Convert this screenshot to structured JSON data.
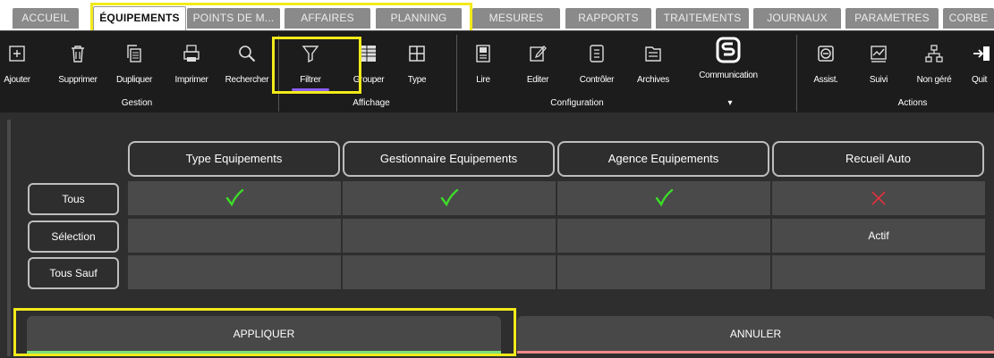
{
  "tabs": [
    {
      "label": "ACCUEIL"
    },
    {
      "label": "ÉQUIPEMENTS"
    },
    {
      "label": "POINTS DE M..."
    },
    {
      "label": "AFFAIRES"
    },
    {
      "label": "PLANNING"
    },
    {
      "label": "MESURES"
    },
    {
      "label": "RAPPORTS"
    },
    {
      "label": "TRAITEMENTS"
    },
    {
      "label": "JOURNAUX"
    },
    {
      "label": "PARAMETRES"
    },
    {
      "label": "CORBE"
    }
  ],
  "ribbon": {
    "buttons": [
      {
        "label": "Ajouter",
        "icon": "add-icon"
      },
      {
        "label": "Supprimer",
        "icon": "trash-icon"
      },
      {
        "label": "Dupliquer",
        "icon": "duplicate-icon"
      },
      {
        "label": "Imprimer",
        "icon": "printer-icon"
      },
      {
        "label": "Rechercher",
        "icon": "search-icon"
      },
      {
        "label": "Filtrer",
        "icon": "filter-icon"
      },
      {
        "label": "Grouper",
        "icon": "group-icon"
      },
      {
        "label": "Type",
        "icon": "grid-icon"
      },
      {
        "label": "Lire",
        "icon": "read-icon"
      },
      {
        "label": "Editer",
        "icon": "edit-icon"
      },
      {
        "label": "Contrôler",
        "icon": "check-icon"
      },
      {
        "label": "Archives",
        "icon": "archive-icon"
      },
      {
        "label": "Communication",
        "icon": "communication-icon"
      },
      {
        "label": "Assist.",
        "icon": "assist-icon"
      },
      {
        "label": "Suivi",
        "icon": "chart-icon"
      },
      {
        "label": "Non géré",
        "icon": "network-icon"
      },
      {
        "label": "Quit",
        "icon": "exit-icon"
      }
    ],
    "groups": {
      "gestion": "Gestion",
      "affichage": "Affichage",
      "configuration": "Configuration",
      "communication_arrow": "▾",
      "actions": "Actions"
    }
  },
  "filter_panel": {
    "columns": [
      "Type Equipements",
      "Gestionnaire Equipements",
      "Agence Equipements",
      "Recueil Auto"
    ],
    "rows": [
      "Tous",
      "Sélection",
      "Tous Sauf"
    ],
    "cells": [
      [
        "check",
        "check",
        "check",
        "cross"
      ],
      [
        "",
        "",
        "",
        "Actif"
      ],
      [
        "",
        "",
        "",
        ""
      ]
    ],
    "apply_label": "APPLIQUER",
    "cancel_label": "ANNULER"
  },
  "colors": {
    "check": "#3ddc2a",
    "cross": "#e0313d",
    "highlight": "#f2ea1a",
    "filter_underline": "#8a5cf5",
    "apply_bar": "#7be07a",
    "cancel_bar": "#f08a8a"
  }
}
